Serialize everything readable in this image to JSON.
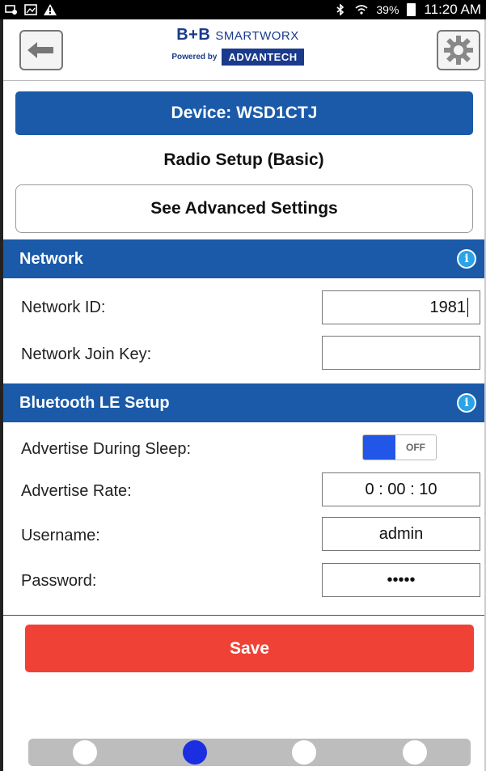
{
  "status_bar": {
    "battery": "39%",
    "time": "11:20 AM"
  },
  "header": {
    "logo_brand_prefix": "B+B ",
    "logo_brand_main": "SmartWorx",
    "logo_powered": "Powered by",
    "logo_partner": "ADVANTECH"
  },
  "device_bar": {
    "text": "Device: WSD1CTJ"
  },
  "page_title": "Radio Setup (Basic)",
  "advanced_button": "See Advanced Settings",
  "network": {
    "title": "Network",
    "network_id_label": "Network ID:",
    "network_id_value": "1981",
    "join_key_label": "Network Join Key:",
    "join_key_value": ""
  },
  "bluetooth": {
    "title": "Bluetooth LE Setup",
    "advertise_sleep_label": "Advertise During Sleep:",
    "advertise_sleep_state": "OFF",
    "advertise_rate_label": "Advertise Rate:",
    "advertise_rate_value": "0 : 00 : 10",
    "username_label": "Username:",
    "username_value": "admin",
    "password_label": "Password:",
    "password_value": "•••••"
  },
  "save_button": "Save",
  "pager": {
    "pages": 4,
    "active_index": 1
  },
  "colors": {
    "primary": "#1a5aa8",
    "save": "#ef4135",
    "info": "#2aa3e8",
    "pager_active": "#1b2fe0"
  },
  "icons": [
    "notification-icon",
    "image-icon",
    "warning-icon",
    "bluetooth-icon",
    "wifi-icon",
    "battery-icon",
    "back-arrow-icon",
    "gear-icon",
    "info-icon"
  ]
}
